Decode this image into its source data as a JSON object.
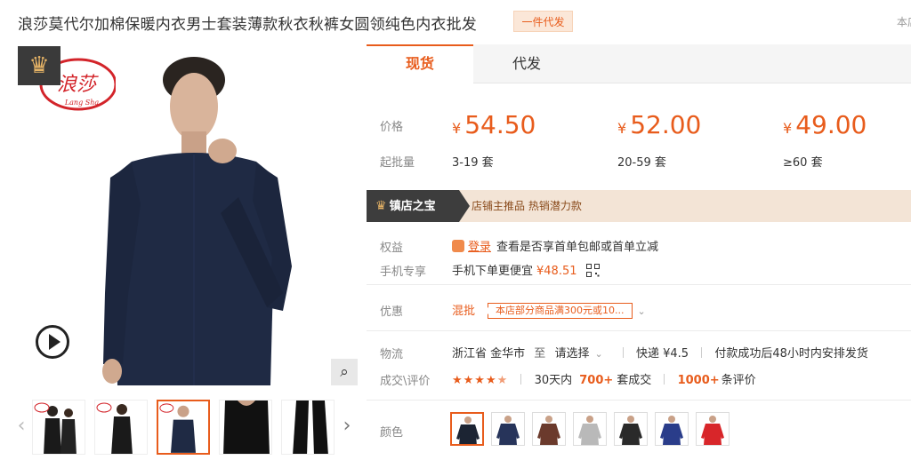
{
  "header": {
    "title": "浪莎莫代尔加棉保暖内衣男士套装薄款秋衣秋裤女圆领纯色内衣批发",
    "dropship_tag": "一件代发",
    "corner_text": "本店"
  },
  "gallery": {
    "thumbnail_count": 5,
    "active_thumbnail": 3
  },
  "tabs": [
    {
      "label": "现货",
      "active": true
    },
    {
      "label": "代发",
      "active": false
    }
  ],
  "pricing": {
    "price_label": "价格",
    "min_qty_label": "起批量",
    "currency": "¥",
    "tiers": [
      {
        "price": "54.50",
        "range": "3-19 套"
      },
      {
        "price": "52.00",
        "range": "20-59 套"
      },
      {
        "price": "49.00",
        "range": "≥60 套"
      }
    ]
  },
  "shop_banner": {
    "badge": "镇店之宝",
    "tags": "店铺主推品  热销潜力款"
  },
  "benefits": {
    "label": "权益",
    "login_link": "登录",
    "text": "查看是否享首单包邮或首单立减"
  },
  "mobile": {
    "label": "手机专享",
    "text": "手机下单更便宜",
    "price": "¥48.51"
  },
  "discount": {
    "label": "优惠",
    "type": "混批",
    "promo": "本店部分商品满300元或10...",
    "arrow": "⌄"
  },
  "logistics": {
    "label": "物流",
    "origin": "浙江省 金华市",
    "to": "至",
    "destination": "请选择",
    "shipping": "快递 ¥4.5",
    "dispatch": "付款成功后48小时内安排发货"
  },
  "reviews": {
    "label": "成交\\评价",
    "rating": 4.5,
    "days_prefix": "30天内",
    "orders": "700+",
    "orders_suffix": "套成交",
    "reviews_count": "1000+",
    "reviews_suffix": "条评价"
  },
  "color": {
    "label": "颜色",
    "swatch_colors": [
      "#1c2433",
      "#27345a",
      "#6b3a2c",
      "#b9b9b9",
      "#2a2a2a",
      "#2a3d8a",
      "#d8262a"
    ],
    "active": 0
  },
  "colors": {
    "accent": "#e85c1c",
    "banner_bg": "#f3e4d6",
    "badge_bg": "#3d3d3d"
  }
}
